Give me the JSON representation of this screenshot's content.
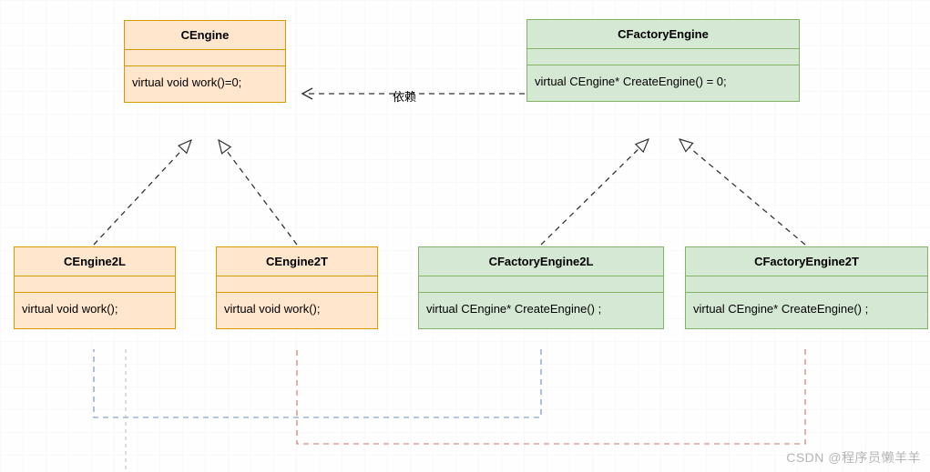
{
  "classes": {
    "cengine": {
      "name": "CEngine",
      "op": "virtual void work()=0;"
    },
    "cengine2l": {
      "name": "CEngine2L",
      "op": "virtual void work();"
    },
    "cengine2t": {
      "name": "CEngine2T",
      "op": "virtual void work();"
    },
    "cfactory": {
      "name": "CFactoryEngine",
      "op": "virtual CEngine* CreateEngine() = 0;"
    },
    "cfactory2l": {
      "name": "CFactoryEngine2L",
      "op": "virtual CEngine* CreateEngine() ;"
    },
    "cfactory2t": {
      "name": "CFactoryEngine2T",
      "op": "virtual CEngine* CreateEngine() ;"
    }
  },
  "relations": {
    "dependency_label": "依赖"
  },
  "watermark": "CSDN @程序员懒羊羊"
}
